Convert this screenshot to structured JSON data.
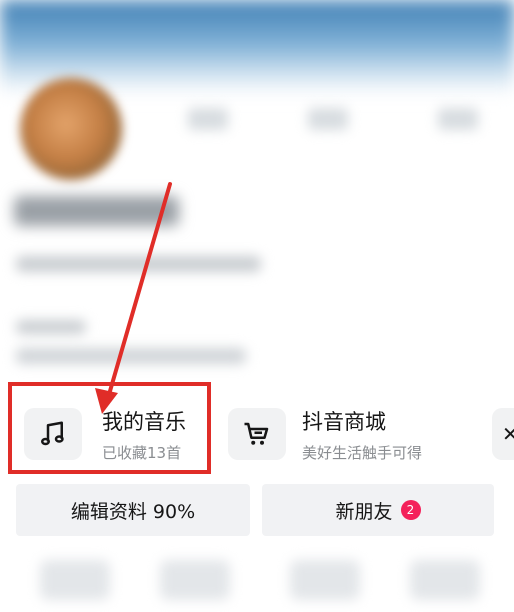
{
  "cards": [
    {
      "title": "我的音乐",
      "subtitle": "已收藏13首",
      "icon": "music-note-icon"
    },
    {
      "title": "抖音商城",
      "subtitle": "美好生活触手可得",
      "icon": "shopping-cart-icon"
    }
  ],
  "buttons": {
    "edit_profile": "编辑资料 90%",
    "new_friends": "新朋友",
    "new_friends_badge": "2"
  },
  "colors": {
    "highlight": "#e02d28",
    "badge": "#f4215a"
  }
}
